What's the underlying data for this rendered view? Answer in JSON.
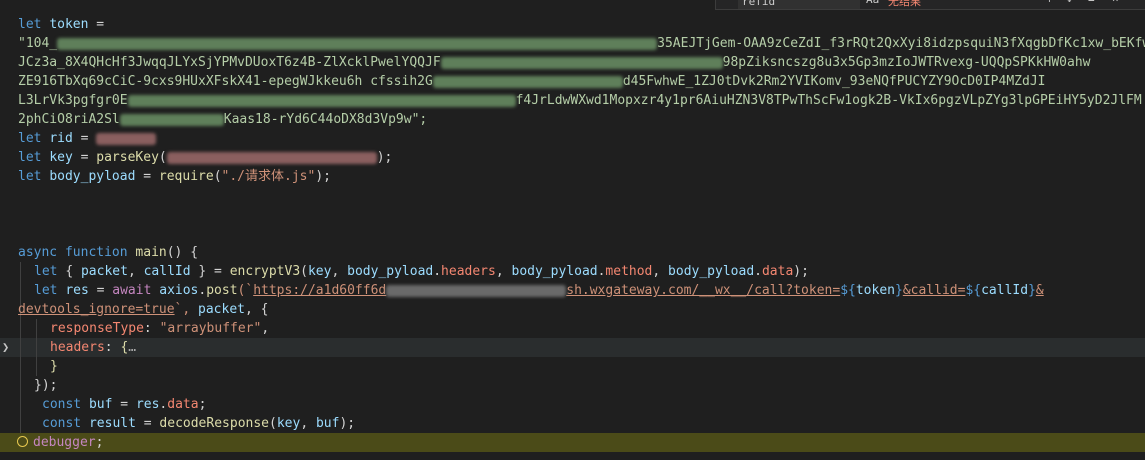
{
  "find_widget": {
    "query": "refid",
    "case_option": "Aa",
    "result": "无结果",
    "prev": "↑",
    "next": "↓",
    "menu": "≡",
    "close": "×"
  },
  "code": {
    "l1_kw": "let",
    "l1_var": "token",
    "l1_eq": "=",
    "l2_start": "\"104_",
    "l2_end": "35AEJTjGem-OAA9zCeZdI_f3rRQt2QxXyi8idzpsquiN3fXqgbDfKc1xw_bEKfwE",
    "l3_start": "JCz3a_8X4QHcHf3JwqqJLYxSjYPMvDUoxT6z4B-ZlXcklPwelYQQJF",
    "l3_end": "98pZiksncszg8u3x5Gp3mzIoJWTRvexg-UQQpSPKkHW0ahw",
    "l4_start": "ZE916TbXq69cCiC-9cxs9HUxXFskX41-epegWJkkeu6h cfssih2G",
    "l4_end": "d45FwhwE_1ZJ0tDvk2Rm2YVIKomv_93eNQfPUCYZY9OcD0IP4MZdJI",
    "l5_start": "L3LrVk3pgfgr0E",
    "l5_mid": "f4JrLdwWXwd1Mopxzr4y1pr6AiuHZN3V8TPwThScFw1ogk2B-VkIx6pgzVLpZYg3lpGPEiHY5yD2JlFM",
    "l6_start": "2phCiO8riA2Sl",
    "l6_end": "Kaas18-rYd6C44oDX8d3Vp9w\";",
    "l7_kw": "let",
    "l7_var": "rid",
    "l7_eq": "=",
    "l8_kw": "let",
    "l8_var": "key",
    "l8_eq": "=",
    "l8_fn": "parseKey",
    "l8_open": "(",
    "l8_close": ");",
    "l9_kw": "let",
    "l9_var": "body_pyload",
    "l9_eq": "=",
    "l9_fn": "require",
    "l9_open": "(",
    "l9_str": "\"./请求体.js\"",
    "l9_close": ");",
    "l13_kw1": "async",
    "l13_kw2": "function",
    "l13_fn": "main",
    "l13_rest": "() {",
    "l14_kw": "let",
    "l14_open": "{",
    "l14_v1": "packet",
    "l14_comma": ",",
    "l14_v2": "callId",
    "l14_closebrace": "}",
    "l14_eq": "=",
    "l14_fn": "encryptV3",
    "l14_p1": "(",
    "l14_a1": "key",
    "l14_c1": ",",
    "l14_a2": "body_pyload",
    "l14_d1": ".",
    "l14_m1": "headers",
    "l14_c2": ",",
    "l14_a3": "body_pyload",
    "l14_d2": ".",
    "l14_m2": "method",
    "l14_c3": ",",
    "l14_a4": "body_pyload",
    "l14_d3": ".",
    "l14_m3": "data",
    "l14_end": ");",
    "l15_kw": "let",
    "l15_var": "res",
    "l15_eq": "=",
    "l15_kw2": "await",
    "l15_obj": "axios",
    "l15_dot": ".",
    "l15_fn": "post",
    "l15_open": "(`",
    "l15_url1": "https://a1d60ff6d",
    "l15_url2": "sh.wxgateway.com/__wx__/call?token=",
    "l15_t1": "${",
    "l15_tv1": "token",
    "l15_t1c": "}",
    "l15_url3": "&callid=",
    "l15_t2": "${",
    "l15_tv2": "callId",
    "l15_t2c": "}",
    "l15_url4": "&",
    "l16_url": "devtools_ignore=true",
    "l16_rest1": "`,",
    "l16_var": "packet",
    "l16_rest2": ", {",
    "l17_prop": "responseType",
    "l17_colon": ":",
    "l17_str": "\"arraybuffer\"",
    "l17_comma": ",",
    "l18_prop": "headers",
    "l18_colon": ":",
    "l18_rest": "{",
    "l18_fold": "…",
    "l19_brace": "}",
    "l20_close": "});",
    "l21_kw": "const",
    "l21_var": "buf",
    "l21_eq": "=",
    "l21_obj": "res",
    "l21_dot": ".",
    "l21_prop": "data",
    "l21_semi": ";",
    "l22_kw": "const",
    "l22_var": "result",
    "l22_eq": "=",
    "l22_fn": "decodeResponse",
    "l22_open": "(",
    "l22_a1": "key",
    "l22_comma": ",",
    "l22_a2": "buf",
    "l22_close": ");",
    "l23_kw": "debugger",
    "l23_semi": ";"
  }
}
